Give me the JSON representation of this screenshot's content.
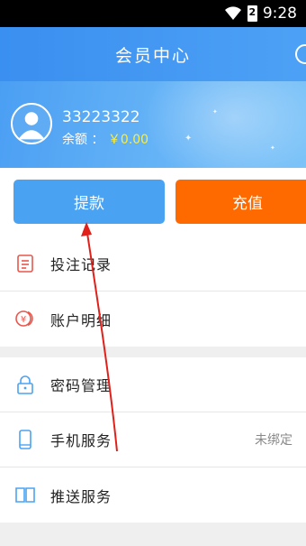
{
  "status_bar": {
    "time": "9:28",
    "battery_label": "2"
  },
  "header": {
    "title": "会员中心"
  },
  "profile": {
    "username": "33223322",
    "balance_label": "余额",
    "balance_sep": "：",
    "balance_value": "￥0.00"
  },
  "actions": {
    "withdraw_label": "提款",
    "recharge_label": "充值"
  },
  "menu": {
    "group1": [
      {
        "label": "投注记录",
        "icon": "betting-record-icon"
      },
      {
        "label": "账户明细",
        "icon": "yen-coin-icon"
      }
    ],
    "group2": [
      {
        "label": "密码管理",
        "icon": "lock-icon"
      },
      {
        "label": "手机服务",
        "icon": "phone-icon",
        "value": "未绑定"
      },
      {
        "label": "推送服务",
        "icon": "book-icon"
      }
    ]
  },
  "colors": {
    "header_blue": "#3a8ff0",
    "withdraw_blue": "#4aa3f2",
    "recharge_orange": "#ff6a00",
    "balance_yellow": "#ffee33",
    "annotation_red": "#e0201a"
  }
}
